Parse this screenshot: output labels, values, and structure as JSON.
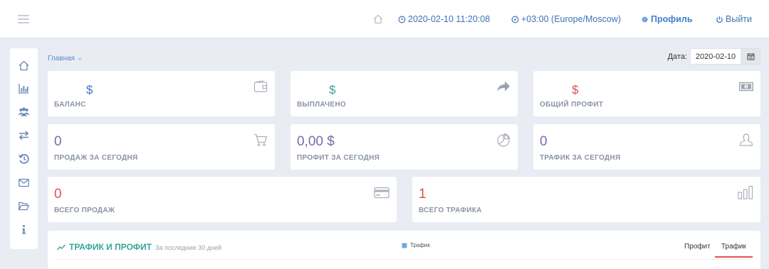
{
  "topbar": {
    "datetime": "2020-02-10 11:20:08",
    "timezone": "+03:00 (Europe/Moscow)",
    "profile_label": "Профиль",
    "logout_label": "Выйти",
    "icons": [
      "menu-icon",
      "home-icon",
      "clock-icon",
      "compass-icon",
      "gear-icon",
      "power-icon"
    ]
  },
  "sidebar": {
    "items": [
      "home-icon",
      "bar-chart-icon",
      "users-icon",
      "exchange-icon",
      "history-icon",
      "mail-icon",
      "folder-open-icon",
      "info-icon"
    ]
  },
  "breadcrumb": {
    "home": "Главная"
  },
  "date_filter": {
    "label": "Дата:",
    "value": "2020-02-10"
  },
  "cards": [
    {
      "value": "$",
      "label": "БАЛАНС",
      "icon": "wallet-icon",
      "color": "#3c78c8"
    },
    {
      "value": "$",
      "label": "ВЫПЛАЧЕНО",
      "icon": "share-icon",
      "color": "#35a69b"
    },
    {
      "value": "$",
      "label": "ОБЩИЙ ПРОФИТ",
      "icon": "money-icon",
      "color": "#d9534f"
    },
    {
      "value": "0",
      "label": "ПРОДАЖ ЗА СЕГОДНЯ",
      "icon": "cart-icon",
      "color": "#7b6aa8"
    },
    {
      "value": "0,00 $",
      "label": "ПРОФИТ ЗА СЕГОДНЯ",
      "icon": "pie-icon",
      "color": "#7b6aa8"
    },
    {
      "value": "0",
      "label": "ТРАФИК ЗА СЕГОДНЯ",
      "icon": "user-icon",
      "color": "#7b6aa8"
    },
    {
      "value": "0",
      "label": "ВСЕГО ПРОДАЖ",
      "icon": "credit-card-icon",
      "color": "#d9534f"
    },
    {
      "value": "1",
      "label": "ВСЕГО ТРАФИКА",
      "icon": "bar-chart-icon",
      "color": "#d9534f"
    }
  ],
  "panel": {
    "title": "ТРАФИК И ПРОФИТ",
    "subtitle": "За последние 30 дней",
    "legend": "Трафик",
    "tabs": [
      "Профит",
      "Трафик"
    ],
    "active_tab": "Трафик",
    "accent": "#35a69b"
  }
}
